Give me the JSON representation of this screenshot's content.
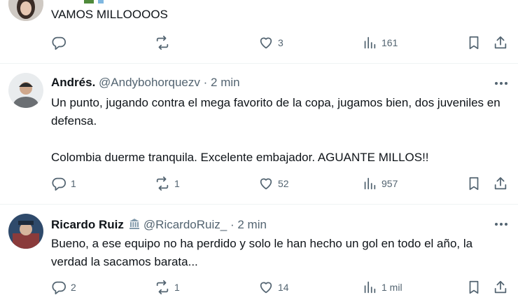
{
  "tweets": [
    {
      "text": "VAMOS MILLOOOOS",
      "actions": {
        "replies": "",
        "reposts": "",
        "likes": "3",
        "views": "161"
      }
    },
    {
      "name": "Andrés.",
      "handle": "@Andybohorquezv",
      "separator": "·",
      "time": "2 min",
      "text": "Un punto, jugando contra el mega favorito de la copa, jugamos bien, dos juveniles en defensa.\n\nColombia duerme tranquila. Excelente embajador. AGUANTE MILLOS!!",
      "actions": {
        "replies": "1",
        "reposts": "1",
        "likes": "52",
        "views": "957"
      }
    },
    {
      "name": "Ricardo Ruiz",
      "handle": "@RicardoRuiz_",
      "separator": "·",
      "time": "2 min",
      "text": "Bueno, a ese equipo no ha perdido y solo le han hecho un gol en todo el año, la verdad la sacamos barata...",
      "actions": {
        "replies": "2",
        "reposts": "1",
        "likes": "14",
        "views": "1 mil"
      }
    }
  ],
  "icons": {
    "reply": "reply-icon",
    "repost": "repost-icon",
    "like": "heart-icon",
    "views": "views-icon",
    "bookmark": "bookmark-icon",
    "share": "share-icon",
    "more": "more-icon",
    "verified": "government-badge-icon"
  },
  "colors": {
    "text": "#0f1419",
    "secondary": "#536471",
    "divider": "#eff3f4"
  }
}
